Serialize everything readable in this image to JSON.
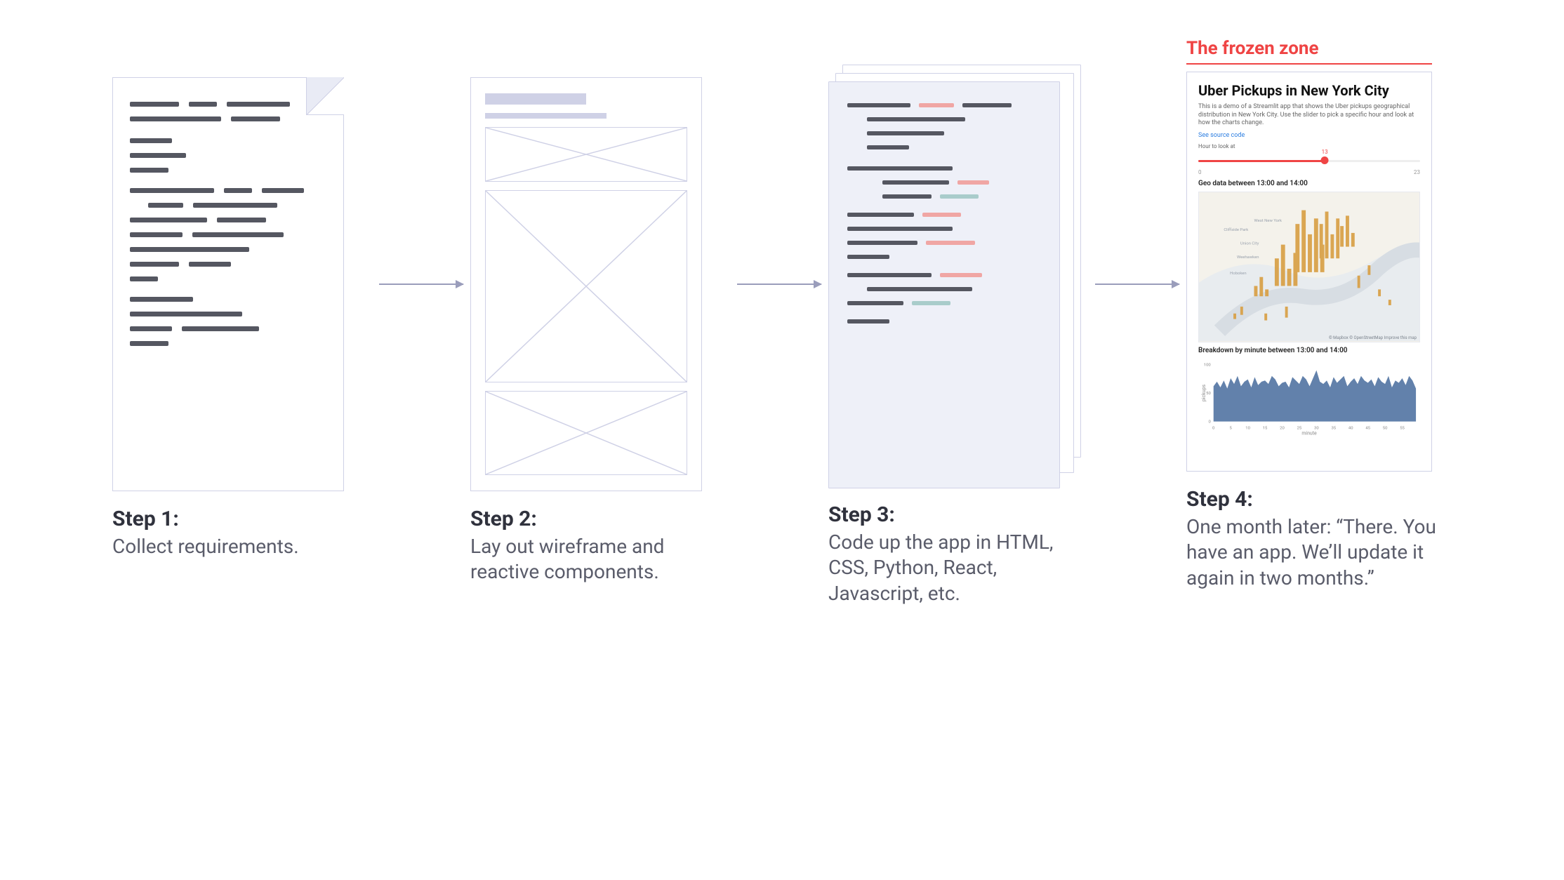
{
  "annotation": {
    "label": "The frozen zone"
  },
  "steps": [
    {
      "heading": "Step 1:",
      "text": "Collect requirements."
    },
    {
      "heading": "Step 2:",
      "text": "Lay out wireframe and reactive components."
    },
    {
      "heading": "Step 3:",
      "text": "Code up the app in HTML, CSS, Python, React, Javascript, etc."
    },
    {
      "heading": "Step 4:",
      "text": "One month later: “There. You have an app. We’ll update it again in two months.”"
    }
  ],
  "app": {
    "title": "Uber Pickups in New York City",
    "subtitle": "This is a demo of a Streamlit app that shows the Uber pickups geographical distribution in New York City. Use the slider to pick a specific hour and look at how the charts change.",
    "source_link": "See source code",
    "slider_label": "Hour to look at",
    "slider_min": "0",
    "slider_max": "23",
    "slider_value": "13",
    "geo_heading": "Geo data between 13:00 and 14:00",
    "map_attribution": "© Mapbox © OpenStreetMap  Improve this map",
    "breakdown_heading": "Breakdown by minute between 13:00 and 14:00",
    "x_axis_label": "minute",
    "y_axis_label": "pickups"
  },
  "chart_data": {
    "type": "area",
    "title": "Breakdown by minute between 13:00 and 14:00",
    "xlabel": "minute",
    "ylabel": "pickups",
    "ylim": [
      0,
      100
    ],
    "x_ticks": [
      0,
      5,
      10,
      15,
      20,
      25,
      30,
      35,
      40,
      45,
      50,
      55
    ],
    "x": [
      0,
      1,
      2,
      3,
      4,
      5,
      6,
      7,
      8,
      9,
      10,
      11,
      12,
      13,
      14,
      15,
      16,
      17,
      18,
      19,
      20,
      21,
      22,
      23,
      24,
      25,
      26,
      27,
      28,
      29,
      30,
      31,
      32,
      33,
      34,
      35,
      36,
      37,
      38,
      39,
      40,
      41,
      42,
      43,
      44,
      45,
      46,
      47,
      48,
      49,
      50,
      51,
      52,
      53,
      54,
      55,
      56,
      57,
      58,
      59
    ],
    "values": [
      62,
      70,
      60,
      72,
      58,
      76,
      66,
      80,
      62,
      70,
      74,
      60,
      78,
      64,
      70,
      72,
      66,
      80,
      74,
      62,
      68,
      70,
      60,
      78,
      72,
      66,
      80,
      74,
      62,
      76,
      90,
      70,
      66,
      72,
      60,
      78,
      68,
      74,
      80,
      62,
      70,
      76,
      66,
      80,
      72,
      68,
      74,
      62,
      78,
      70,
      66,
      80,
      60,
      72,
      68,
      76,
      64,
      80,
      72,
      58
    ]
  }
}
